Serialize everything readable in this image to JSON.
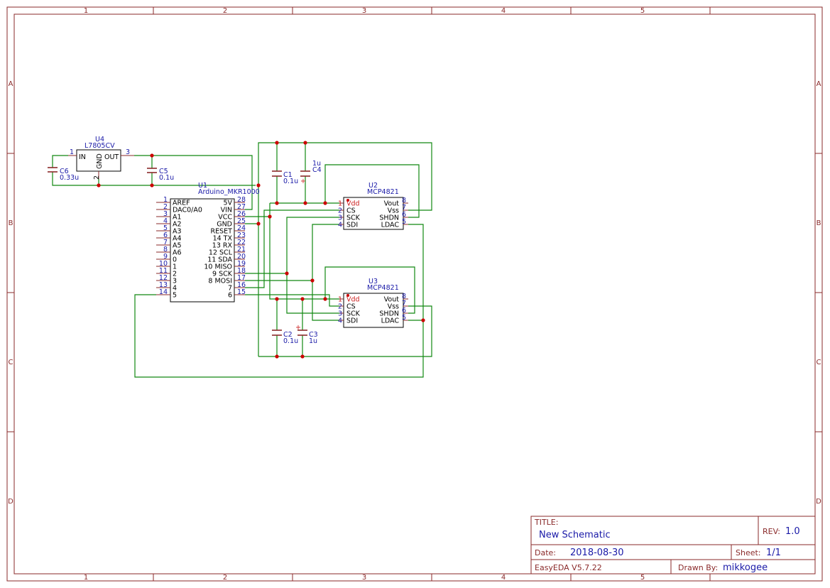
{
  "border": {
    "columns": [
      "1",
      "2",
      "3",
      "4",
      "5"
    ],
    "rows": [
      "A",
      "B",
      "C",
      "D"
    ]
  },
  "regulator": {
    "ref": "U4",
    "value": "L7805CV",
    "pins": {
      "in_num": "1",
      "in": "IN",
      "out": "OUT",
      "out_num": "3",
      "gnd": "GND",
      "gnd_num": "2"
    }
  },
  "arduino": {
    "ref": "U1",
    "value": "Arduino_MKR1000",
    "left_pins": [
      {
        "num": "1",
        "name": "AREF"
      },
      {
        "num": "2",
        "name": "DAC0/A0"
      },
      {
        "num": "3",
        "name": "A1"
      },
      {
        "num": "4",
        "name": "A2"
      },
      {
        "num": "5",
        "name": "A3"
      },
      {
        "num": "6",
        "name": "A4"
      },
      {
        "num": "7",
        "name": "A5"
      },
      {
        "num": "8",
        "name": "A6"
      },
      {
        "num": "9",
        "name": "0"
      },
      {
        "num": "10",
        "name": "1"
      },
      {
        "num": "11",
        "name": "2"
      },
      {
        "num": "12",
        "name": "3"
      },
      {
        "num": "13",
        "name": "4"
      },
      {
        "num": "14",
        "name": "5"
      }
    ],
    "right_pins": [
      {
        "num": "28",
        "name": "5V"
      },
      {
        "num": "27",
        "name": "VIN"
      },
      {
        "num": "26",
        "name": "VCC"
      },
      {
        "num": "25",
        "name": "GND"
      },
      {
        "num": "24",
        "name": "RESET"
      },
      {
        "num": "23",
        "name": "14 TX"
      },
      {
        "num": "22",
        "name": "13 RX"
      },
      {
        "num": "21",
        "name": "12 SCL"
      },
      {
        "num": "20",
        "name": "11 SDA"
      },
      {
        "num": "19",
        "name": "10 MISO"
      },
      {
        "num": "18",
        "name": "9 SCK"
      },
      {
        "num": "17",
        "name": "8 MOSI"
      },
      {
        "num": "16",
        "name": "7"
      },
      {
        "num": "15",
        "name": "6"
      }
    ]
  },
  "dacs": [
    {
      "ref": "U2",
      "value": "MCP4821",
      "left_pins": [
        {
          "num": "1",
          "name": "Vdd"
        },
        {
          "num": "2",
          "name": "CS"
        },
        {
          "num": "3",
          "name": "SCK"
        },
        {
          "num": "4",
          "name": "SDI"
        }
      ],
      "right_pins": [
        {
          "num": "8",
          "name": "Vout"
        },
        {
          "num": "7",
          "name": "Vss"
        },
        {
          "num": "6",
          "name": "SHDN"
        },
        {
          "num": "5",
          "name": "LDAC"
        }
      ]
    },
    {
      "ref": "U3",
      "value": "MCP4821",
      "left_pins": [
        {
          "num": "1",
          "name": "Vdd"
        },
        {
          "num": "2",
          "name": "CS"
        },
        {
          "num": "3",
          "name": "SCK"
        },
        {
          "num": "4",
          "name": "SDI"
        }
      ],
      "right_pins": [
        {
          "num": "8",
          "name": "Vout"
        },
        {
          "num": "7",
          "name": "Vss"
        },
        {
          "num": "6",
          "name": "SHDN"
        },
        {
          "num": "5",
          "name": "LDAC"
        }
      ]
    }
  ],
  "capacitors": [
    {
      "ref": "C6",
      "value": "0.33u"
    },
    {
      "ref": "C5",
      "value": "0.1u"
    },
    {
      "ref": "C1",
      "value": "0.1u"
    },
    {
      "ref": "C4",
      "value": "1u"
    },
    {
      "ref": "C2",
      "value": "0.1u"
    },
    {
      "ref": "C3",
      "value": "1u"
    }
  ],
  "title_block": {
    "title_label": "TITLE:",
    "title": "New Schematic",
    "rev_label": "REV:",
    "rev": "1.0",
    "date_label": "Date:",
    "date": "2018-08-30",
    "sheet_label": "Sheet:",
    "sheet": "1/1",
    "tool": "EasyEDA V5.7.22",
    "drawn_label": "Drawn By:",
    "drawn_by": "mikkogee"
  }
}
